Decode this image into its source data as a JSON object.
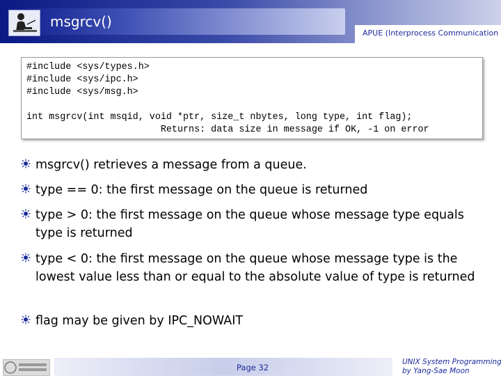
{
  "header": {
    "title": "msgrcv()",
    "subtitle": "APUE (Interprocess Communication",
    "logo_icon": "person-at-desk-icon"
  },
  "code": {
    "lines": [
      "#include <sys/types.h>",
      "#include <sys/ipc.h>",
      "#include <sys/msg.h>",
      "",
      "int msgrcv(int msqid, void *ptr, size_t nbytes, long type, int flag);",
      "                        Returns: data size in message if OK, -1 on error"
    ]
  },
  "bullets": [
    "msgrcv() retrieves a message from a queue.",
    "type == 0: the first message on the queue is returned",
    "type > 0: the first message on the queue whose message type equals type is returned",
    "type < 0: the first message on the queue whose message type is the lowest value less than or equal to the absolute value of type is returned",
    "flag may be given by IPC_NOWAIT"
  ],
  "footer": {
    "page": "Page 32",
    "credit_line1": "UNIX System Programming",
    "credit_line2": "by Yang-Sae Moon",
    "logo_icon": "university-logo-icon"
  },
  "colors": {
    "header_dark": "#0b1a84",
    "accent_text": "#1a2a9a"
  }
}
